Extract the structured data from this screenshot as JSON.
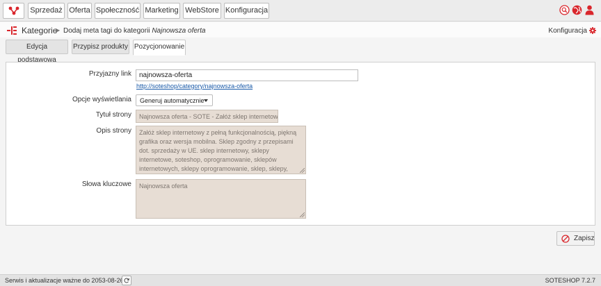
{
  "menu": {
    "items": [
      {
        "label": "Sprzedaż"
      },
      {
        "label": "Oferta"
      },
      {
        "label": "Społeczność"
      },
      {
        "label": "Marketing"
      },
      {
        "label": "WebStore"
      },
      {
        "label": "Konfiguracja"
      }
    ]
  },
  "top_icons": [
    "search-icon",
    "globe-icon",
    "user-icon"
  ],
  "breadcrumb": {
    "section": "Kategorie",
    "action": "Dodaj meta tagi do kategorii",
    "category": "Najnowsza oferta"
  },
  "config_link": "Konfiguracja",
  "tabs": [
    {
      "label": "Edycja podstawowa",
      "active": false
    },
    {
      "label": "Przypisz produkty",
      "active": false
    },
    {
      "label": "Pozycjonowanie",
      "active": true
    }
  ],
  "form": {
    "friendly_link": {
      "label": "Przyjazny link",
      "value": "najnowsza-oferta",
      "url": "http://soteshop/category/najnowsza-oferta"
    },
    "display_options": {
      "label": "Opcje wyświetlania",
      "selected": "Generuj automatycznie"
    },
    "page_title": {
      "label": "Tytuł strony",
      "value": "Najnowsza oferta - SOTE - Załóż sklep internetowy"
    },
    "page_description": {
      "label": "Opis strony",
      "value": "Załóż sklep internetowy z pełną funkcjonalnością, piękną grafika oraz wersja mobilna. Sklep zgodny  z przepisami dot. sprzedaży w UE. sklep internetowy, sklepy internetowe, soteshop, oprogramowanie, sklepów internetowych, sklepy oprogramowanie, sklep, sklepy, funkcjonalność sklepu,"
    },
    "keywords": {
      "label": "Słowa kluczowe",
      "value": "Najnowsza oferta"
    }
  },
  "save_label": "Zapisz",
  "footer": {
    "service_text": "Serwis i aktualizacje ważne do 2053-08-26",
    "version": "SOTESHOP 7.2.7"
  },
  "colors": {
    "accent": "#d9262c",
    "readonly_bg": "#e7ddd4",
    "link": "#1a5aa8"
  }
}
